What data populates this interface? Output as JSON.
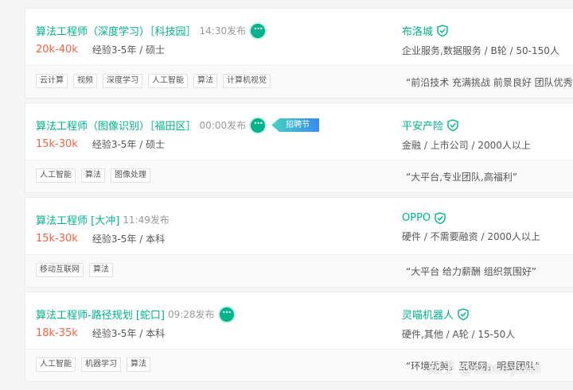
{
  "jobs": [
    {
      "title": "算法工程师（深度学习）［科技园］",
      "time": "14:30发布",
      "salary": "20k-40k",
      "requirements": "经验3-5年 / 硕士",
      "company": "布洛城",
      "company_info": "企业服务,数据服务 / B轮 / 50-150人",
      "tags": [
        "云计算",
        "视频",
        "深度学习",
        "人工智能",
        "算法",
        "计算机视觉"
      ],
      "slogan": "“前沿技术 充满挑战 前景良好 团队优秀”"
    },
    {
      "title": "算法工程师（图像识别）［福田区］",
      "time": "00:00发布",
      "promo": "招聘节",
      "salary": "15k-30k",
      "requirements": "经验3-5年 / 硕士",
      "company": "平安产险",
      "company_info": "金融 / 上市公司 / 2000人以上",
      "tags": [
        "人工智能",
        "算法",
        "图像处理"
      ],
      "slogan": "“大平台,专业团队,高福利”"
    },
    {
      "title": "算法工程师 [大冲]",
      "time": "11:49发布",
      "salary": "15k-30k",
      "requirements": "经验3-5年 / 本科",
      "company": "OPPO",
      "company_info": "硬件 / 不需要融资 / 2000人以上",
      "tags": [
        "移动互联网",
        "算法"
      ],
      "slogan": "“大平台 给力薪酬 组织氛围好”"
    },
    {
      "title": "算法工程师-路径规划 [蛇口]",
      "time": "09:28发布",
      "salary": "18k-35k",
      "requirements": "经验3-5年 / 本科",
      "company": "灵喵机器人",
      "company_info": "硬件,其他 / A轮 / 15-50人",
      "tags": [
        "人工智能",
        "机器学习",
        "算法"
      ],
      "slogan": "“环境优美，互联网，明星团队”"
    }
  ],
  "watermark": "知乎 @staceywei",
  "colors": {
    "accent": "#00b38a",
    "salary": "#fa6041"
  }
}
